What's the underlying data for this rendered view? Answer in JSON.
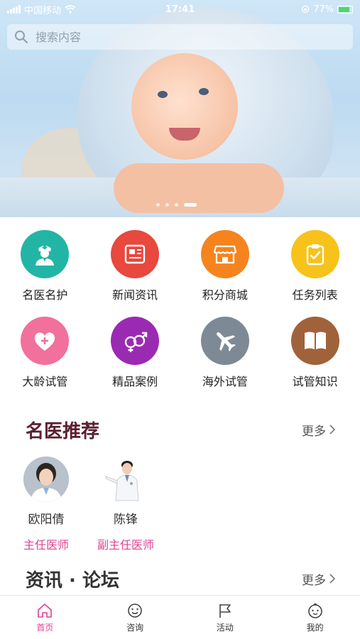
{
  "status_bar": {
    "carrier": "中国移动",
    "time": "17:41",
    "battery": "77%"
  },
  "search": {
    "placeholder": "搜索内容"
  },
  "banner": {
    "slides": 4,
    "active_slide": 4
  },
  "menu": {
    "row1": [
      {
        "label": "名医名护",
        "icon": "doctor-icon",
        "color": "#22b5a6"
      },
      {
        "label": "新闻资讯",
        "icon": "news-icon",
        "color": "#e8483e"
      },
      {
        "label": "积分商城",
        "icon": "shop-icon",
        "color": "#f5841f"
      },
      {
        "label": "任务列表",
        "icon": "clipboard-icon",
        "color": "#f7c21a"
      }
    ],
    "row2": [
      {
        "label": "大龄试管",
        "icon": "heart-plus-icon",
        "color": "#f2709c"
      },
      {
        "label": "精品案例",
        "icon": "gender-icon",
        "color": "#9b2ab3"
      },
      {
        "label": "海外试管",
        "icon": "airplane-icon",
        "color": "#7d8a96"
      },
      {
        "label": "试管知识",
        "icon": "book-icon",
        "color": "#a0623a"
      }
    ]
  },
  "doctors_section": {
    "title": "名医推荐",
    "more": "更多",
    "doctors": [
      {
        "name": "欧阳倩",
        "title": "主任医师"
      },
      {
        "name": "陈锋",
        "title": "副主任医师"
      }
    ]
  },
  "news_section": {
    "title": "资讯 · 论坛",
    "more": "更多"
  },
  "tabbar": {
    "tabs": [
      {
        "label": "首页",
        "icon": "home-icon"
      },
      {
        "label": "咨询",
        "icon": "smiley-chat-icon"
      },
      {
        "label": "活动",
        "icon": "flag-icon"
      },
      {
        "label": "我的",
        "icon": "baby-face-icon"
      }
    ],
    "active_color": "#e0418f"
  }
}
